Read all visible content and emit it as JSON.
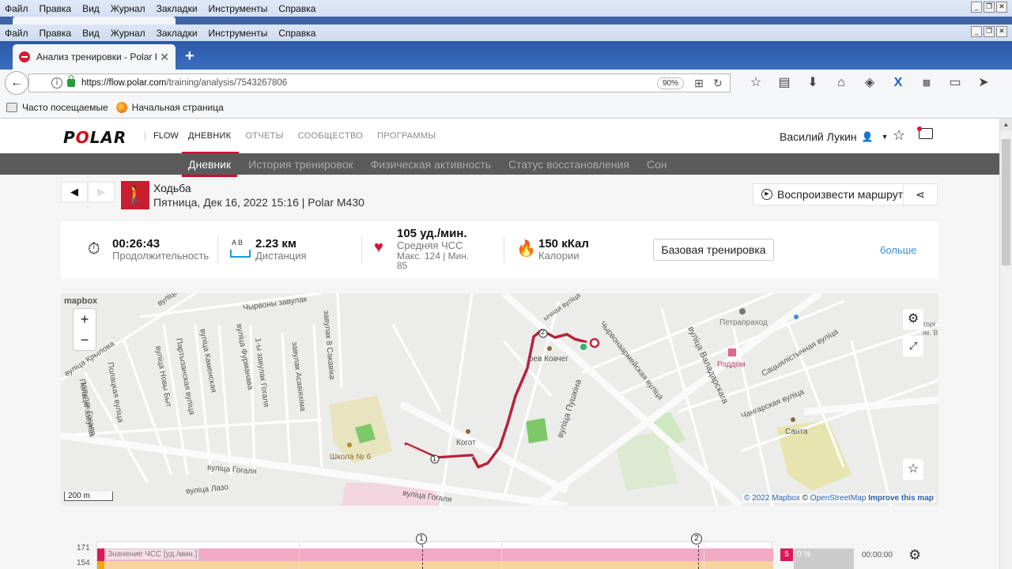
{
  "browser": {
    "menu": [
      "Файл",
      "Правка",
      "Вид",
      "Журнал",
      "Закладки",
      "Инструменты",
      "Справка"
    ],
    "tab_title": "Анализ тренировки - Polar F...",
    "url_host": "https://flow.polar.com",
    "url_path": "/training/analysis/7543267806",
    "zoom": "90%",
    "bookmarks": [
      "Часто посещаемые",
      "Начальная страница"
    ]
  },
  "header": {
    "logo": "POLAR",
    "flow": "FLOW",
    "nav": [
      "ДНЕВНИК",
      "ОТЧЕТЫ",
      "СООБЩЕСТВО",
      "ПРОГРАММЫ"
    ],
    "user": "Василий Лукин"
  },
  "subnav": [
    "Дневник",
    "История тренировок",
    "Физическая активность",
    "Статус восстановления",
    "Сон"
  ],
  "session": {
    "title": "Ходьба",
    "subtitle": "Пятница, Дек 16, 2022 15:16 | Polar M430",
    "replay_label": "Воспроизвести маршрут"
  },
  "summary": {
    "duration": {
      "value": "00:26:43",
      "label": "Продолжительность"
    },
    "distance": {
      "value": "2.23 км",
      "label": "Дистанция",
      "icon_text": "A  B"
    },
    "hr": {
      "value": "105 уд./мин.",
      "label": "Средняя ЧСС",
      "detail": "Макс. 124  |  Мин.",
      "detail2": "85"
    },
    "calories": {
      "value": "150 кКал",
      "label": "Калории"
    },
    "type_button": "Базовая тренировка",
    "more": "больше"
  },
  "map": {
    "mapbox_logo": "mapbox",
    "scale": "200 m",
    "attribution_copy": "© 2022",
    "attribution_mapbox": "Mapbox",
    "attribution_sep": "©",
    "attribution_osm": "OpenStreetMap",
    "attribution_improve": "Improve this map",
    "labels": {
      "krylova": "вуліца Крылова",
      "chyrvony": "Чырвоны завулак",
      "furmanava": "вуліца Фурманава",
      "kamenskaia": "вуліца Каменская",
      "partyzanskaia": "Партызанская вуліца",
      "novybyt": "вуліца Новы Быт",
      "polackaia": "Полацкая вуліца",
      "gogalia_zav": "завулак Гогаля",
      "polacki_zav": "Полацкі завулак",
      "first_gogalia": "1-ы завулак Гогаля",
      "asaviakhima": "завулак Асавіяхіма",
      "sakavika": "завулак 8 Сакавіка",
      "gogalia": "вуліца Гогаля",
      "laza": "вуліца Лазо",
      "gogalia2": "вуліца Гогаля",
      "school": "Школа № 6",
      "kovcheg": "оев Ковчег",
      "kogot": "Когот",
      "pushkina": "вуліца Пушкіна",
      "chyrvonaarmeiskaia": "Чырвонаармейская вуліца",
      "valadarskaga": "вуліца Валадарскага",
      "petrapraxod": "Петрапраход",
      "roddom": "Роддом",
      "satsyialistychnaia": "Сацыялістычная вуліца",
      "changarskaia": "Чангарская вуліца",
      "santa": "Санта",
      "vulitsa_top": "вуліца",
      "savetskaia": "ычная вуліца",
      "museum": "торі\nім. В.І. Лен",
      "vul_k": "вуліца К"
    },
    "laps": [
      "1",
      "2"
    ]
  },
  "chart": {
    "y_labels": [
      "171",
      "154"
    ],
    "series_label": "Значение ЧСС [уд./мин.]",
    "laps": [
      "1",
      "2"
    ],
    "zone": "5",
    "zone_percent": "0 %",
    "zone_time": "00:00:00"
  }
}
